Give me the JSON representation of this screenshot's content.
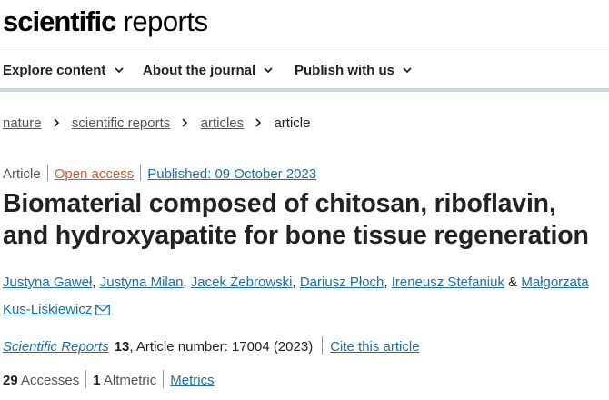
{
  "site": {
    "logo_bold": "scientific",
    "logo_light": "reports"
  },
  "nav": {
    "items": [
      {
        "label": "Explore content"
      },
      {
        "label": "About the journal"
      },
      {
        "label": "Publish with us"
      }
    ]
  },
  "breadcrumb": {
    "items": [
      "nature",
      "scientific reports",
      "articles"
    ],
    "current": "article"
  },
  "article": {
    "type": "Article",
    "access": "Open access",
    "published": "Published: 09 October 2023",
    "title": "Biomaterial composed of chitosan, riboflavin, and hydroxyapatite for bone tissue regeneration",
    "authors": [
      "Justyna Gaweł",
      "Justyna Milan",
      "Jacek Żebrowski",
      "Dariusz Płoch",
      "Ireneusz Stefaniuk",
      "Małgorzata Kus-Liśkiewicz"
    ],
    "author_sep": ", ",
    "author_amp": " & ",
    "corresponding_icon": "mail-icon"
  },
  "citation": {
    "journal": "Scientific Reports",
    "volume": "13",
    "rest": ", Article number: 17004 (2023)",
    "cite_label": "Cite this article"
  },
  "metrics": {
    "accesses_count": "29",
    "accesses_label": "Accesses",
    "altmetric_count": "1",
    "altmetric_label": "Altmetric",
    "metrics_link": "Metrics"
  },
  "colors": {
    "link": "#1d6fa5",
    "open_access": "#d05c2c",
    "nav_rule": "#c8d6de"
  }
}
